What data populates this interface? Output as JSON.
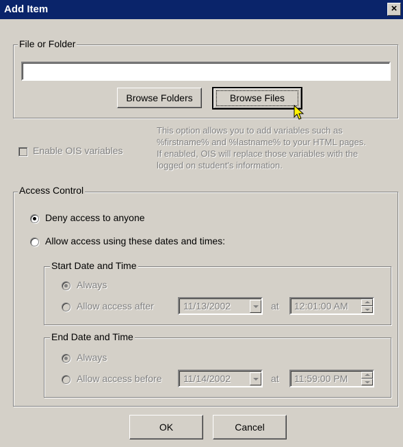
{
  "window": {
    "title": "Add Item",
    "close_glyph": "×"
  },
  "file_group": {
    "legend": "File or Folder",
    "path_value": "",
    "browse_folders_label": "Browse Folders",
    "browse_files_label": "Browse Files"
  },
  "ois": {
    "checkbox_label": "Enable OIS variables",
    "checked": false,
    "enabled": false,
    "description_lines": [
      "This option allows you to add variables such as",
      "%firstname% and %lastname% to your HTML pages.",
      "If enabled, OIS will replace those variables with the",
      "logged on student's information."
    ]
  },
  "access": {
    "legend": "Access Control",
    "deny_label": "Deny access to anyone",
    "allow_label": "Allow access using these dates and times:",
    "selected": "deny",
    "start": {
      "legend": "Start Date and Time",
      "always_label": "Always",
      "after_label": "Allow access after",
      "date": "11/13/2002",
      "at_label": "at",
      "time": "12:01:00 AM"
    },
    "end": {
      "legend": "End Date and Time",
      "always_label": "Always",
      "before_label": "Allow access before",
      "date": "11/14/2002",
      "at_label": "at",
      "time": "11:59:00 PM"
    }
  },
  "buttons": {
    "ok_label": "OK",
    "cancel_label": "Cancel"
  },
  "colors": {
    "titlebar": "#0a246a",
    "face": "#d4d0c8",
    "disabled_text": "#808080"
  }
}
